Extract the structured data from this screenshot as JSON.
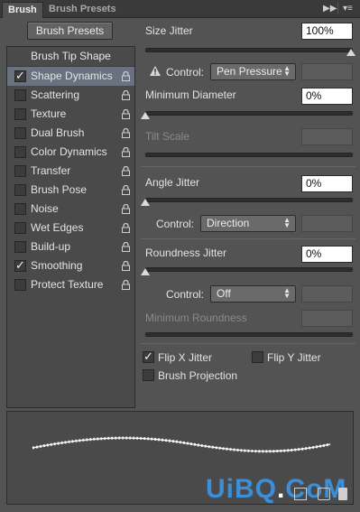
{
  "tabs": {
    "brush": "Brush",
    "brush_presets": "Brush Presets"
  },
  "left": {
    "presets_button": "Brush Presets",
    "tip_shape_header": "Brush Tip Shape",
    "items": [
      {
        "label": "Shape Dynamics",
        "checked": true,
        "selected": true,
        "lock": "lock-icon"
      },
      {
        "label": "Scattering",
        "checked": false,
        "lock": "lock-icon"
      },
      {
        "label": "Texture",
        "checked": false,
        "lock": "lock-icon"
      },
      {
        "label": "Dual Brush",
        "checked": false,
        "lock": "lock-icon"
      },
      {
        "label": "Color Dynamics",
        "checked": false,
        "lock": "lock-icon"
      },
      {
        "label": "Transfer",
        "checked": false,
        "lock": "lock-icon"
      },
      {
        "label": "Brush Pose",
        "checked": false,
        "lock": "lock-icon"
      },
      {
        "label": "Noise",
        "checked": false,
        "lock": "lock-icon"
      },
      {
        "label": "Wet Edges",
        "checked": false,
        "lock": "lock-icon"
      },
      {
        "label": "Build-up",
        "checked": false,
        "lock": "lock-icon"
      },
      {
        "label": "Smoothing",
        "checked": true,
        "lock": "lock-icon"
      },
      {
        "label": "Protect Texture",
        "checked": false,
        "lock": "lock-icon"
      }
    ]
  },
  "right": {
    "size_jitter": {
      "label": "Size Jitter",
      "value": "100%",
      "slider": 1.0
    },
    "control1": {
      "label": "Control:",
      "value": "Pen Pressure",
      "warning_icon": "warning-icon"
    },
    "min_diameter": {
      "label": "Minimum Diameter",
      "value": "0%",
      "slider": 0.0
    },
    "tilt_scale": {
      "label": "Tilt Scale"
    },
    "angle_jitter": {
      "label": "Angle Jitter",
      "value": "0%",
      "slider": 0.0
    },
    "control2": {
      "label": "Control:",
      "value": "Direction"
    },
    "roundness_jitter": {
      "label": "Roundness Jitter",
      "value": "0%",
      "slider": 0.0
    },
    "control3": {
      "label": "Control:",
      "value": "Off"
    },
    "min_roundness": {
      "label": "Minimum Roundness"
    },
    "flip_x": {
      "label": "Flip X Jitter",
      "checked": true
    },
    "flip_y": {
      "label": "Flip Y Jitter",
      "checked": false
    },
    "brush_projection": {
      "label": "Brush Projection",
      "checked": false
    }
  },
  "watermark": {
    "text": "UiBQ.CoM",
    "color_main": "#3a8fd8",
    "color_dot": "#ffffff"
  },
  "colors": {
    "panel": "#535353",
    "tabbar": "#3a3a3a",
    "selected": "#6a7280"
  }
}
